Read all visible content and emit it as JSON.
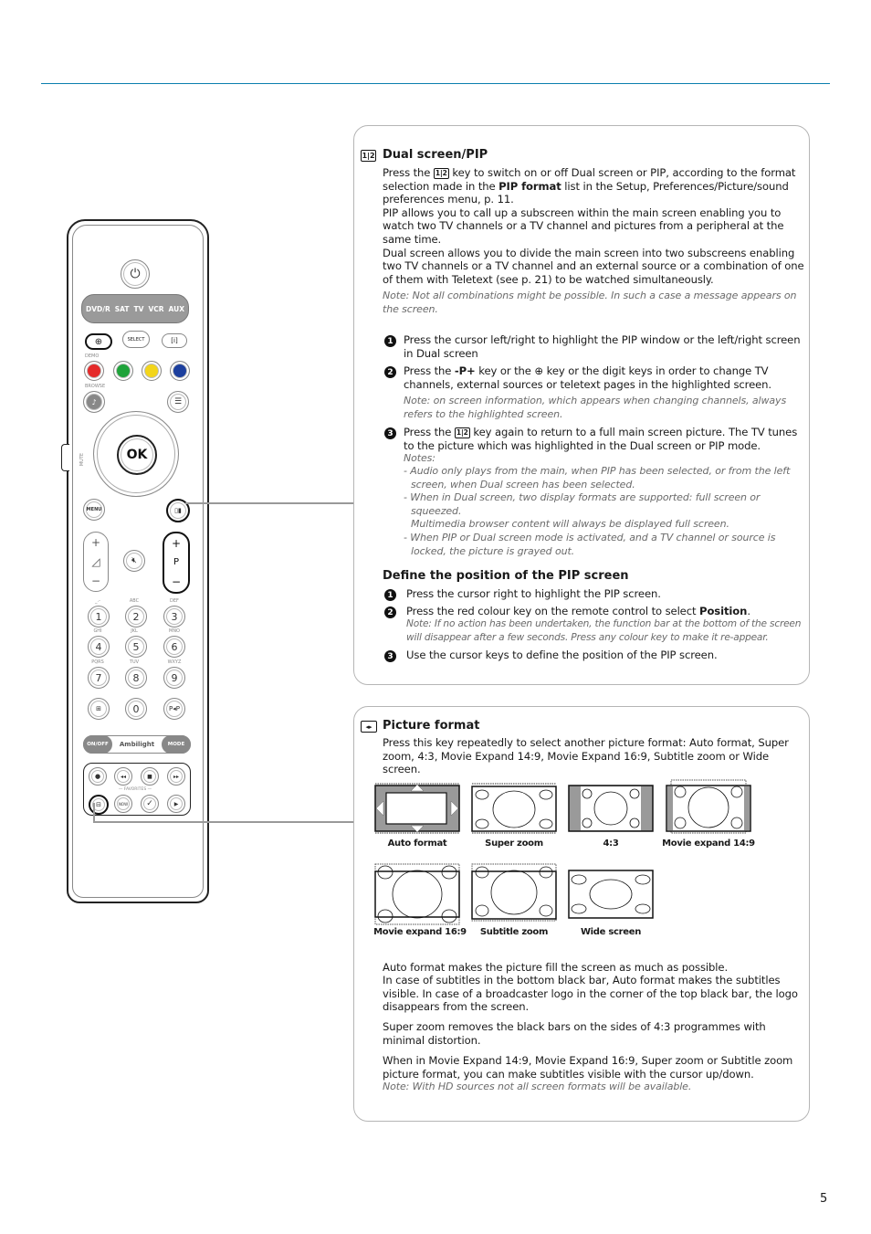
{
  "page_number": "5",
  "dual_screen": {
    "icon": "1|2",
    "title": "Dual screen/PIP",
    "intro_p1_a": "Press the",
    "intro_p1_b": "key to switch on or off Dual screen or PIP, according to the format selection made in the",
    "intro_p1_bold": "PIP format",
    "intro_p1_c": "list in the Setup, Preferences/Picture/sound preferences menu, p. 11.",
    "intro_p2": "PIP allows you to call up a subscreen within the main screen enabling you to watch two TV channels or a TV channel and pictures from a peripheral at the same time.",
    "intro_p3": "Dual screen allows you to divide the main screen into two subscreens enabling two TV channels or a TV channel and an external source or a combination of one of them with Teletext (see p. 21) to be watched simultaneously.",
    "intro_note": "Note: Not all combinations might be possible. In such a case a message appears on the screen.",
    "steps": [
      {
        "num": "1",
        "text": "Press the cursor left/right to highlight the PIP window or the left/right screen in Dual screen"
      },
      {
        "num": "2",
        "text_a": "Press the",
        "bold": "-P+",
        "text_b": "key or the",
        "text_c": "key or the digit keys in order to change TV channels, external sources or teletext pages in the highlighted screen.",
        "note": "Note: on screen information, which appears when changing channels, always refers to the highlighted screen."
      },
      {
        "num": "3",
        "text_a": "Press the",
        "text_b": "key again to return to a full main screen picture. The TV tunes to the picture which was highlighted in the Dual screen or PIP mode.",
        "notes_title": "Notes:",
        "notes": [
          "- Audio only plays from the main, when PIP has been selected, or from the left screen, when Dual screen has been selected.",
          "- When in Dual screen, two display formats are supported: full screen or squeezed.",
          "Multimedia browser content will always be displayed full screen.",
          "- When PIP or Dual screen mode is activated, and a TV channel or source is locked, the picture is grayed out."
        ]
      }
    ]
  },
  "pip_position": {
    "title": "Define the position of the PIP screen",
    "steps": [
      {
        "num": "1",
        "text": "Press the cursor right to highlight the PIP screen."
      },
      {
        "num": "2",
        "text_a": "Press the red colour key on the remote control to select",
        "bold": "Position",
        "text_b": ".",
        "note": "Note: If no action has been undertaken, the function bar at the bottom of the screen will disappear after a few seconds. Press any colour key to make it re-appear."
      },
      {
        "num": "3",
        "text": "Use the cursor keys to define the position of the PIP screen."
      }
    ]
  },
  "picture_format": {
    "title": "Picture format",
    "intro": "Press this key repeatedly to select another picture format: Auto format, Super zoom, 4:3, Movie Expand 14:9, Movie Expand 16:9, Subtitle zoom or Wide screen.",
    "formats": [
      "Auto format",
      "Super zoom",
      "4:3",
      "Movie expand 14:9",
      "Movie expand 16:9",
      "Subtitle zoom",
      "Wide screen"
    ],
    "p1": "Auto format makes the picture fill the screen as much as possible.",
    "p2": "In case of subtitles in the bottom black bar, Auto format makes the subtitles visible. In case of a broadcaster logo in the corner of the top black bar, the logo disappears from the screen.",
    "p3": "Super zoom removes the black bars on the sides of 4:3 programmes with minimal distortion.",
    "p4": "When in Movie Expand 14:9, Movie Expand 16:9, Super zoom or Subtitle zoom picture format, you can make subtitles visible with the cursor up/down.",
    "note": "Note: With HD sources not all screen formats will be available."
  },
  "remote": {
    "sources": [
      "DVD/R",
      "SAT",
      "TV",
      "VCR",
      "AUX"
    ],
    "select": "SELECT",
    "demo": "DEMO",
    "browse": "BROWSE",
    "ok": "OK",
    "menu": "MENU",
    "mute_label": "MUTE",
    "p": "P",
    "digits": [
      "1",
      "2",
      "3",
      "4",
      "5",
      "6",
      "7",
      "8",
      "9",
      "0"
    ],
    "digit_letters": [
      "_.-",
      "ABC",
      "DEF",
      "GHI",
      "JKL",
      "MNO",
      "PQRS",
      "TUV",
      "WXYZ"
    ],
    "pip_key": "P◂P",
    "onoff": "ON/OFF",
    "ambilight": "Ambilight",
    "mode": "MODE",
    "favorites": "— FAVORITES —",
    "now": "NOW",
    "colors": {
      "red": "#e52a2a",
      "green": "#1ea33a",
      "yellow": "#f3d51a",
      "blue": "#1c3f9e"
    }
  }
}
